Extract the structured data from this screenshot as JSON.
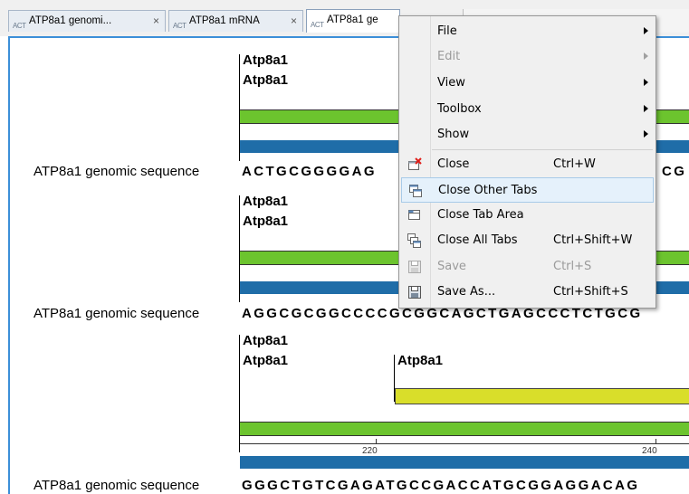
{
  "tabs": [
    {
      "label": "ATP8a1 genomi...",
      "icon": "sequence-icon",
      "icon_glyph": "ACT",
      "close": "×"
    },
    {
      "label": "ATP8a1 mRNA",
      "icon": "sequence-icon",
      "icon_glyph": "ACT",
      "close": "×"
    },
    {
      "label": "ATP8a1 ge",
      "icon": "sequence-icon",
      "icon_glyph": "ACT"
    }
  ],
  "rows": [
    {
      "annotations": [
        "Atp8a1",
        "Atp8a1"
      ],
      "sequence_name": "ATP8a1 genomic sequence",
      "sequence": "ACTGCGGGGAG",
      "sequence_tail": "CG"
    },
    {
      "annotations": [
        "Atp8a1",
        "Atp8a1"
      ],
      "sequence_name": "ATP8a1 genomic sequence",
      "sequence": "AGGCGCGGCCCCGCGGCAGCTGAGCCCTCTGCG"
    },
    {
      "annotations": [
        "Atp8a1",
        "Atp8a1"
      ],
      "extra_annotation": "Atp8a1",
      "ruler_ticks": [
        "220",
        "240"
      ],
      "sequence_name": "ATP8a1 genomic sequence",
      "sequence": "GGGCTGTCGAGATGCCGACCATGCGGAGGACAG"
    }
  ],
  "context_menu": {
    "items": [
      {
        "label": "File",
        "submenu": true,
        "enabled": true
      },
      {
        "label": "Edit",
        "submenu": true,
        "enabled": false
      },
      {
        "label": "View",
        "submenu": true,
        "enabled": true
      },
      {
        "label": "Toolbox",
        "submenu": true,
        "enabled": true
      },
      {
        "label": "Show",
        "submenu": true,
        "enabled": true
      },
      {
        "label": "Close",
        "shortcut": "Ctrl+W",
        "icon": "close-tab-icon",
        "enabled": true
      },
      {
        "label": "Close Other Tabs",
        "icon": "close-other-tabs-icon",
        "enabled": true,
        "highlighted": true
      },
      {
        "label": "Close Tab Area",
        "icon": "close-tab-area-icon",
        "enabled": true
      },
      {
        "label": "Close All Tabs",
        "shortcut": "Ctrl+Shift+W",
        "icon": "close-all-tabs-icon",
        "enabled": true
      },
      {
        "label": "Save",
        "shortcut": "Ctrl+S",
        "icon": "save-icon",
        "enabled": false
      },
      {
        "label": "Save As...",
        "shortcut": "Ctrl+Shift+S",
        "icon": "save-as-icon",
        "enabled": true
      }
    ]
  },
  "colors": {
    "gene_bar": "#6cc42e",
    "mrna_bar": "#1f6da8",
    "cds_bar": "#d9de2a",
    "active_pane_border": "#3c8fd8",
    "menu_highlight": "#e5f1fb"
  }
}
